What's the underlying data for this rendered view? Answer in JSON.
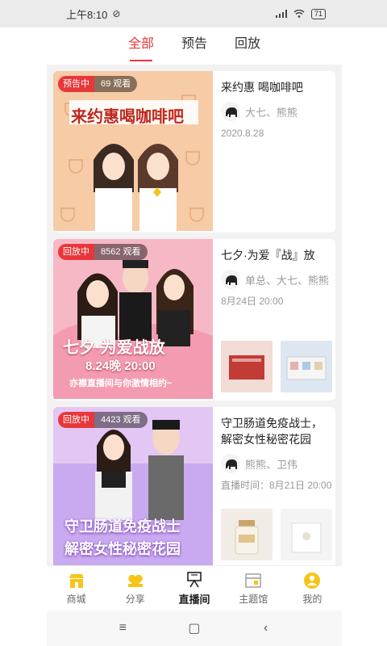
{
  "status_bar": {
    "time": "上午8:10",
    "battery": "71"
  },
  "tabs": [
    {
      "label": "全部",
      "active": true
    },
    {
      "label": "预告",
      "active": false
    },
    {
      "label": "回放",
      "active": false
    }
  ],
  "cards": [
    {
      "state": "预告中",
      "views": "69 观看",
      "poster_title": "来约惠喝咖啡吧",
      "title": "来约惠 喝咖啡吧",
      "hosts": "大七、熊熊",
      "date": "2020.8.28",
      "poster_bg": "#f4c9a4"
    },
    {
      "state": "回放中",
      "views": "8562 观看",
      "poster_title": "七夕·为爱战放",
      "poster_sub": "8.24晚 20:00",
      "poster_sub2": "亦襟直播间与你激情相约~",
      "title": "七夕·为爱『战』放",
      "hosts": "单总、大七、熊熊",
      "date": "8月24日 20:00",
      "poster_bg": "#f6b6c4"
    },
    {
      "state": "回放中",
      "views": "4423 观看",
      "poster_title": "守卫肠道免疫战士",
      "poster_title2": "解密女性秘密花园",
      "title": "守卫肠道免疫战士，解密女性秘密花园",
      "hosts": "熊熊、卫伟",
      "date": "直播时间：8月21日 20:00",
      "poster_bg": "#c8a8ee"
    }
  ],
  "bottom_nav": [
    {
      "label": "商城",
      "icon": "shop-icon",
      "active": false
    },
    {
      "label": "分享",
      "icon": "share-icon",
      "active": false
    },
    {
      "label": "直播间",
      "icon": "live-icon",
      "active": true
    },
    {
      "label": "主题馆",
      "icon": "theme-hall-icon",
      "active": false
    },
    {
      "label": "我的",
      "icon": "profile-icon",
      "active": false
    }
  ],
  "colors": {
    "accent": "#e8373a",
    "nav_icon": "#f5c518"
  }
}
